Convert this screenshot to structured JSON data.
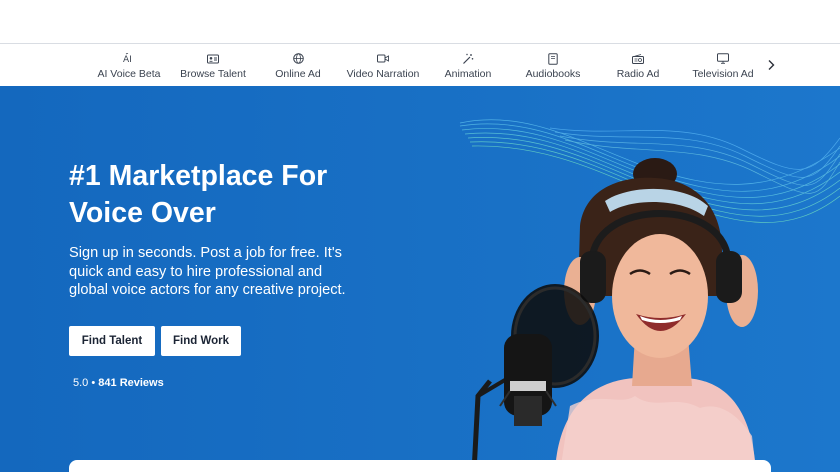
{
  "nav": {
    "categories": [
      {
        "label": "AI Voice Beta",
        "icon": "ai-icon"
      },
      {
        "label": "Browse Talent",
        "icon": "id-card-icon"
      },
      {
        "label": "Online Ad",
        "icon": "globe-icon"
      },
      {
        "label": "Video Narration",
        "icon": "video-camera-icon"
      },
      {
        "label": "Animation",
        "icon": "magic-wand-icon"
      },
      {
        "label": "Audiobooks",
        "icon": "book-icon"
      },
      {
        "label": "Radio Ad",
        "icon": "radio-icon"
      },
      {
        "label": "Television Ad",
        "icon": "monitor-icon"
      }
    ],
    "next_icon": "chevron-right-icon"
  },
  "hero": {
    "title": "#1 Marketplace For Voice Over",
    "subtitle": "Sign up in seconds. Post a job for free. It's quick and easy to hire professional and global voice actors for any creative project.",
    "find_talent_label": "Find Talent",
    "find_work_label": "Find Work",
    "rating_score": "5.0",
    "rating_sep": "•",
    "rating_reviews": "841 Reviews"
  },
  "colors": {
    "hero_bg": "#1468be",
    "nav_text": "#3b4350",
    "button_bg": "#ffffff"
  }
}
